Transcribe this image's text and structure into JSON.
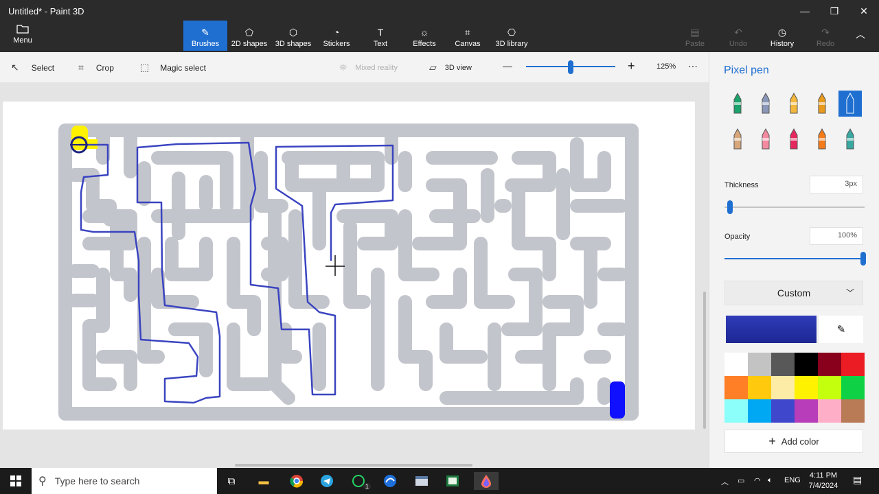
{
  "window": {
    "title": "Untitled* - Paint 3D"
  },
  "window_controls": {
    "minimize": "—",
    "restore": "❐",
    "close": "✕"
  },
  "ribbon": {
    "menu_label": "Menu",
    "tabs": [
      {
        "label": "Brushes",
        "icon": "brush-icon"
      },
      {
        "label": "2D shapes",
        "icon": "2d-shapes-icon"
      },
      {
        "label": "3D shapes",
        "icon": "3d-shapes-icon"
      },
      {
        "label": "Stickers",
        "icon": "stickers-icon"
      },
      {
        "label": "Text",
        "icon": "text-icon"
      },
      {
        "label": "Effects",
        "icon": "effects-icon"
      },
      {
        "label": "Canvas",
        "icon": "canvas-icon"
      },
      {
        "label": "3D library",
        "icon": "3d-library-icon"
      }
    ],
    "active_tab": "Brushes",
    "right": [
      {
        "label": "Paste",
        "enabled": false
      },
      {
        "label": "Undo",
        "enabled": false
      },
      {
        "label": "History",
        "enabled": true
      },
      {
        "label": "Redo",
        "enabled": false
      }
    ]
  },
  "toolbar": {
    "select": "Select",
    "crop": "Crop",
    "magic_select": "Magic select",
    "mixed_reality": "Mixed reality",
    "view_3d": "3D view",
    "zoom": "125%",
    "more": "⋯",
    "zoom_out": "—",
    "zoom_in": "+",
    "zoom_fraction": 0.5
  },
  "panel": {
    "title": "Pixel pen",
    "brushes": [
      {
        "name": "marker",
        "color": "#1aa36b"
      },
      {
        "name": "calligraphy-pen",
        "color": "#8a97b8"
      },
      {
        "name": "oil-brush",
        "color": "#f3b83c"
      },
      {
        "name": "watercolor",
        "color": "#e89a1d"
      },
      {
        "name": "pixel-pen",
        "color": "#1f6fd1",
        "selected": true
      },
      {
        "name": "pencil",
        "color": "#d7a77a"
      },
      {
        "name": "eraser",
        "color": "#f38aa0"
      },
      {
        "name": "crayon",
        "color": "#e5285e"
      },
      {
        "name": "spray-can",
        "color": "#f47b1a"
      },
      {
        "name": "fill",
        "color": "#38a8a0"
      }
    ],
    "thickness_label": "Thickness",
    "thickness_value": "3px",
    "thickness_fraction": 0.04,
    "opacity_label": "Opacity",
    "opacity_value": "100%",
    "opacity_fraction": 1.0,
    "color_dropdown": "Custom",
    "current_color": "#2f3bb8",
    "swatches": [
      "#ffffff",
      "#c3c3c3",
      "#585858",
      "#000000",
      "#88001b",
      "#ec1c24",
      "#ff7f27",
      "#ffc90e",
      "#fdeca6",
      "#fff200",
      "#c4ff0e",
      "#0ed145",
      "#8cfffb",
      "#00a8f3",
      "#3f48cc",
      "#b83dba",
      "#ffaec8",
      "#b97a56"
    ],
    "add_color": "Add color"
  },
  "maze": {
    "wall_color": "#c3c5cc",
    "path_color": "#3a44c0",
    "start_color": "#fff200",
    "end_color": "#1010ff"
  },
  "taskbar": {
    "search_placeholder": "Type here to search",
    "apps": [
      "task-view",
      "file-explorer",
      "chrome",
      "telegram",
      "whatsapp",
      "edge-dev",
      "generic-app",
      "excel-app",
      "paint-3d"
    ],
    "whatsapp_badge": "1",
    "lang": "ENG",
    "time": "4:11 PM",
    "date": "7/4/2024"
  }
}
